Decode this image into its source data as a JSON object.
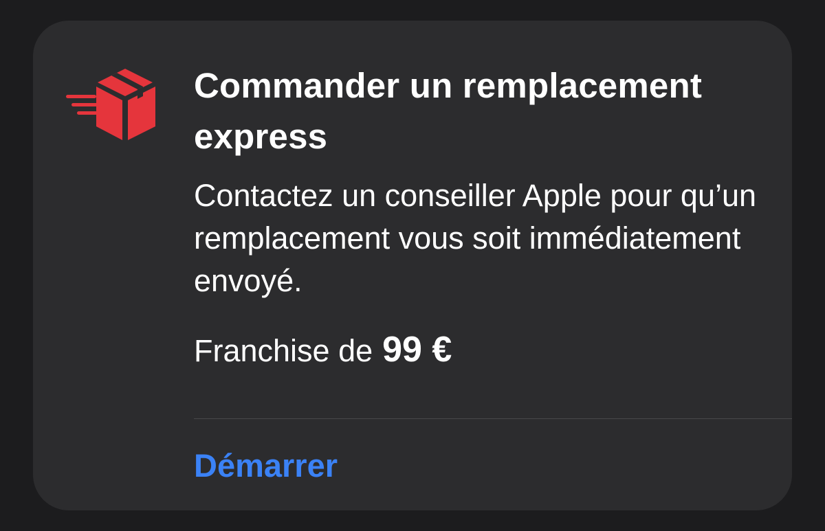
{
  "card": {
    "icon": "express-delivery-box-icon",
    "icon_color": "#e5353c",
    "title": "Commander un remplacement express",
    "description": "Contactez un conseiller Apple pour qu’un remplacement vous soit immédiatement envoyé.",
    "fee_label": "Franchise de",
    "fee_amount": "99 €",
    "action_label": "Démarrer",
    "action_color": "#3b82f6"
  }
}
